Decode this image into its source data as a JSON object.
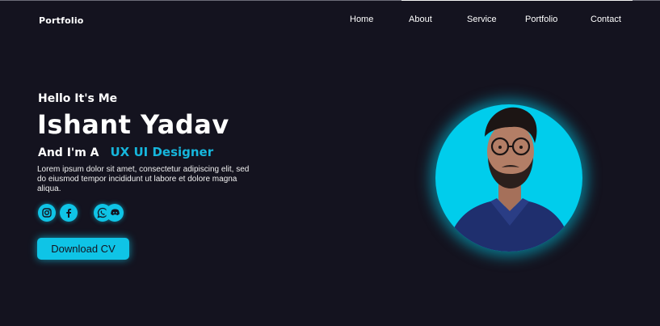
{
  "header": {
    "logo": "Portfolio",
    "nav": [
      "Home",
      "About",
      "Service",
      "Portfolio",
      "Contact"
    ]
  },
  "hero": {
    "greeting": "Hello It's Me",
    "name": "Ishant Yadav",
    "role_prefix": "And I'm A",
    "role": "UX UI Designer",
    "description": "Lorem ipsum dolor sit amet, consectetur adipiscing elit, sed do eiusmod tempor incididunt ut labore et dolore magna aliqua.",
    "social": [
      "instagram-icon",
      "facebook-icon",
      "whatsapp-icon",
      "discord-icon"
    ],
    "cta": "Download CV"
  },
  "colors": {
    "background": "#14131f",
    "accent": "#0fc4e6",
    "accent_text": "#16b6dc"
  }
}
